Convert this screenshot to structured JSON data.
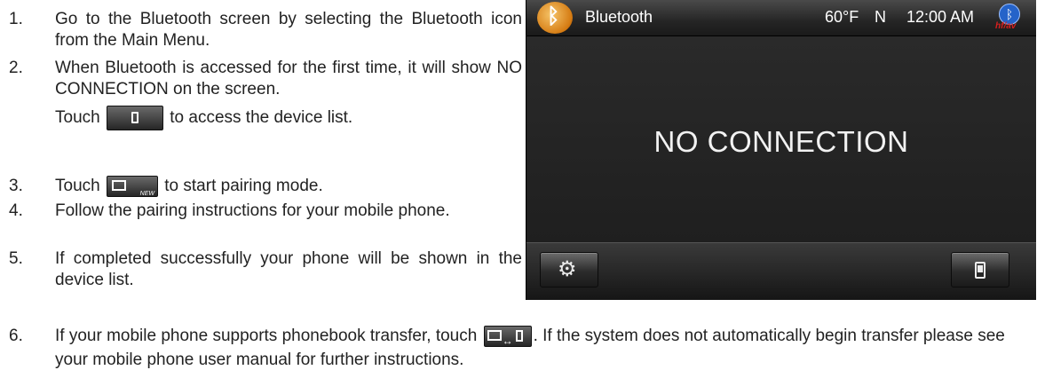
{
  "steps": [
    {
      "num": "1.",
      "text": "Go to the Bluetooth screen by selecting the Bluetooth icon from the Main Menu."
    },
    {
      "num": "2.",
      "text_a": "When Bluetooth is accessed for the first time, it will show NO CONNECTION on the screen.",
      "text_b": "Touch",
      "text_c": "to access the device list."
    },
    {
      "num": "3.",
      "text_a": "Touch",
      "text_b": "to start pairing mode."
    },
    {
      "num": "4.",
      "text": "Follow the pairing instructions for your mobile phone."
    },
    {
      "num": "5.",
      "text": "If completed successfully your phone will be shown in the device list."
    },
    {
      "num": "6.",
      "text_a": "If your mobile phone supports phonebook transfer, touch",
      "text_b": ". If the system does not automatically begin transfer please see your mobile phone user manual for further instructions."
    }
  ],
  "inline_icons": {
    "new_tag": "NEW"
  },
  "screen": {
    "title": "Bluetooth",
    "temperature": "60°F",
    "direction": "N",
    "time": "12:00 AM",
    "hf_label": "hf/av",
    "bt_symbol": "ᛒ",
    "status_message": "NO CONNECTION",
    "settings_icon": "gear-icon",
    "device_icon": "phone-icon",
    "gear_glyph": "⚙"
  },
  "colors": {
    "bt_logo": "#d57b12",
    "bt_status": "#2563c9",
    "hf_label": "#d81f1f"
  }
}
